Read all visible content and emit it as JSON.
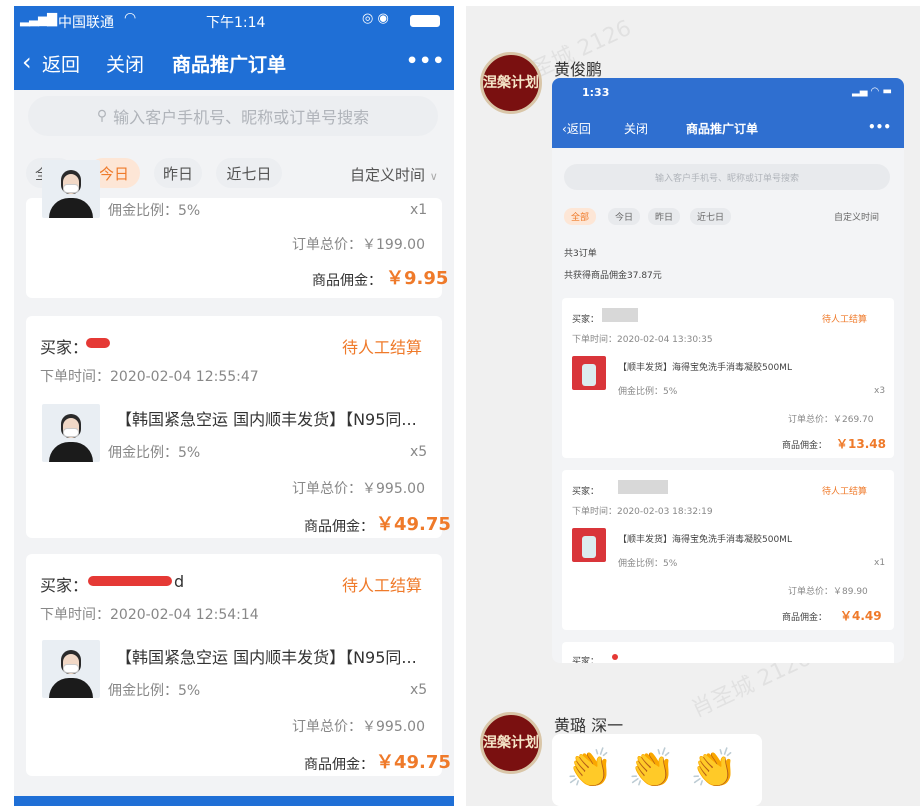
{
  "left": {
    "status": {
      "carrier": "中国联通",
      "time": "下午1:14"
    },
    "nav": {
      "back": "返回",
      "close": "关闭",
      "title": "商品推广订单",
      "more": "•••"
    },
    "search_placeholder": "输入客户手机号、昵称或订单号搜索",
    "filters": [
      "全部",
      "今日",
      "昨日",
      "近七日"
    ],
    "custom_time": "自定义时间",
    "partial_card": {
      "commission_rate": "佣金比例：5%",
      "qty": "x1",
      "total": "订单总价：￥199.00",
      "commission_label": "商品佣金：",
      "commission_value": "￥9.95"
    },
    "orders": [
      {
        "buyer": "买家：",
        "status": "待人工结算",
        "time": "下单时间：2020-02-04 12:55:47",
        "product": "【韩国紧急空运 国内顺丰发货】【N95同...",
        "commission_rate": "佣金比例：5%",
        "qty": "x5",
        "total": "订单总价：￥995.00",
        "commission_label": "商品佣金：",
        "commission_value": "￥49.75"
      },
      {
        "buyer": "买家：",
        "buyer_tail": "d",
        "status": "待人工结算",
        "time": "下单时间：2020-02-04 12:54:14",
        "product": "【韩国紧急空运 国内顺丰发货】【N95同...",
        "commission_rate": "佣金比例：5%",
        "qty": "x5",
        "total": "订单总价：￥995.00",
        "commission_label": "商品佣金：",
        "commission_value": "￥49.75"
      }
    ]
  },
  "right": {
    "sender1": "黄俊鹏",
    "sender2": "黄璐 深一",
    "avatar_text": "涅槃计划",
    "watermark": "肖圣城 2126",
    "shot": {
      "time": "1:33",
      "nav": {
        "back": "返回",
        "close": "关闭",
        "title": "商品推广订单",
        "more": "•••"
      },
      "search_placeholder": "输入客户手机号、昵称或订单号搜索",
      "filters": [
        "全部",
        "今日",
        "昨日",
        "近七日"
      ],
      "custom_time": "自定义时间",
      "summary_count": "共3订单",
      "summary_commission": "共获得商品佣金37.87元",
      "orders": [
        {
          "buyer": "买家：",
          "status": "待人工结算",
          "time": "下单时间：2020-02-04 13:30:35",
          "product": "【顺丰发货】海得宝免洗手消毒凝胶500ML",
          "commission_rate": "佣金比例：5%",
          "qty": "x3",
          "total": "订单总价：￥269.70",
          "commission_label": "商品佣金：",
          "commission_value": "￥13.48"
        },
        {
          "buyer": "买家：",
          "status": "待人工结算",
          "time": "下单时间：2020-02-03 18:32:19",
          "product": "【顺丰发货】海得宝免洗手消毒凝胶500ML",
          "commission_rate": "佣金比例：5%",
          "qty": "x1",
          "total": "订单总价：￥89.90",
          "commission_label": "商品佣金：",
          "commission_value": "￥4.49"
        }
      ],
      "partial_buyer": "买家："
    },
    "emoji": "👏"
  }
}
